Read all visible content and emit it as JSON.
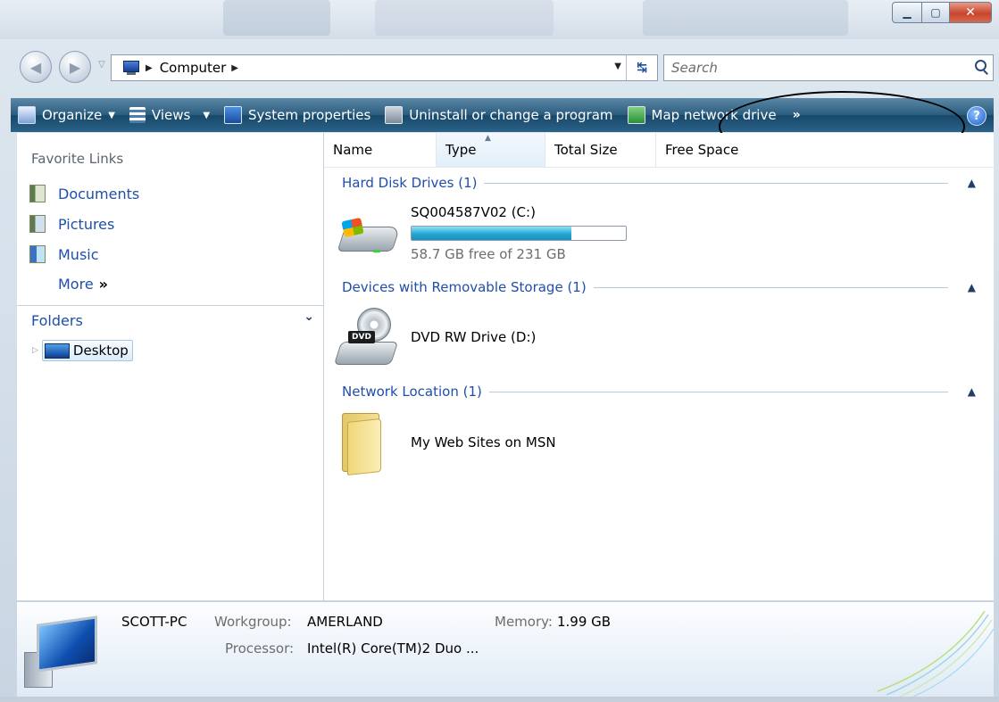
{
  "address": {
    "crumbs": [
      "Computer"
    ],
    "search_placeholder": "Search"
  },
  "toolbar": {
    "organize": "Organize",
    "views": "Views",
    "system_properties": "System properties",
    "uninstall": "Uninstall or change a program",
    "map_network_drive": "Map network drive",
    "more": "»"
  },
  "nav": {
    "favorites_header": "Favorite Links",
    "favorites": [
      "Documents",
      "Pictures",
      "Music"
    ],
    "more": "More",
    "more_chevron": "»",
    "folders_header": "Folders",
    "tree_root": "Desktop"
  },
  "columns": [
    "Name",
    "Type",
    "Total Size",
    "Free Space"
  ],
  "groups": {
    "hard_disk": {
      "header": "Hard Disk Drives (1)",
      "drive_name": "SQ004587V02 (C:)",
      "free_text": "58.7 GB free of 231 GB",
      "used_fraction": 0.746
    },
    "removable": {
      "header": "Devices with Removable Storage (1)",
      "drive_name": "DVD RW Drive (D:)",
      "dvd_label": "DVD"
    },
    "network": {
      "header": "Network Location (1)",
      "item_name": "My Web Sites on MSN"
    }
  },
  "details": {
    "computer_name": "SCOTT-PC",
    "workgroup_label": "Workgroup:",
    "workgroup_value": "AMERLAND",
    "memory_label": "Memory:",
    "memory_value": "1.99 GB",
    "processor_label": "Processor:",
    "processor_value": "Intel(R) Core(TM)2 Duo ..."
  },
  "colors": {
    "link_blue": "#1f4fa8",
    "command_bar": "#2a5c7f",
    "capacity_fill": "#24a7d3"
  }
}
